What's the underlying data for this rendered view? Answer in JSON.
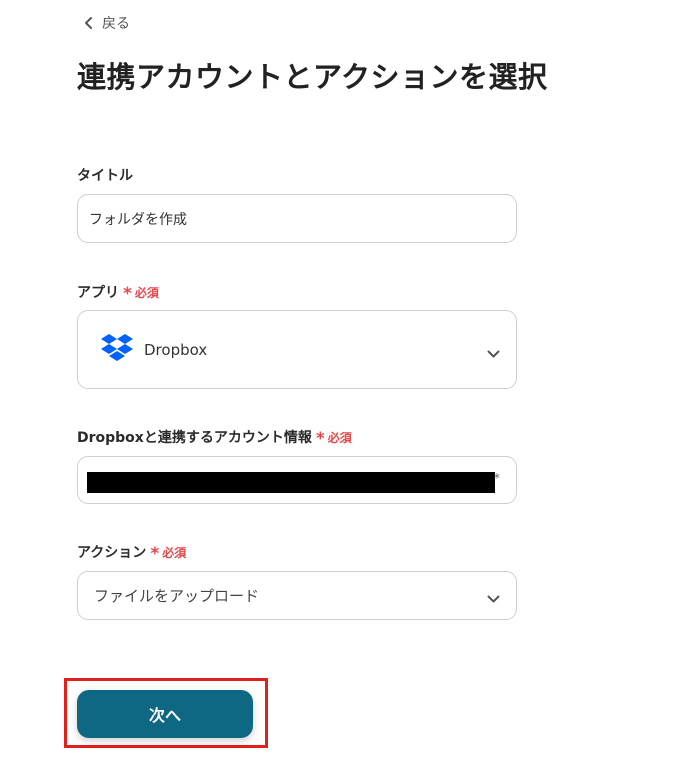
{
  "back": {
    "label": "戻る"
  },
  "page": {
    "title": "連携アカウントとアクションを選択"
  },
  "fields": {
    "title": {
      "label": "タイトル",
      "value": "フォルダを作成"
    },
    "app": {
      "label": "アプリ",
      "required_label": "必須",
      "value": "Dropbox",
      "icon": "dropbox-logo"
    },
    "account": {
      "label": "Dropboxと連携するアカウント情報",
      "required_label": "必須",
      "mask_char": "*"
    },
    "action": {
      "label": "アクション",
      "required_label": "必須",
      "value": "ファイルをアップロード"
    }
  },
  "footer": {
    "next_label": "次へ"
  },
  "colors": {
    "primary": "#0e6783",
    "required": "#e5484d",
    "highlight": "#e0201a",
    "dropbox": "#0061fe"
  }
}
